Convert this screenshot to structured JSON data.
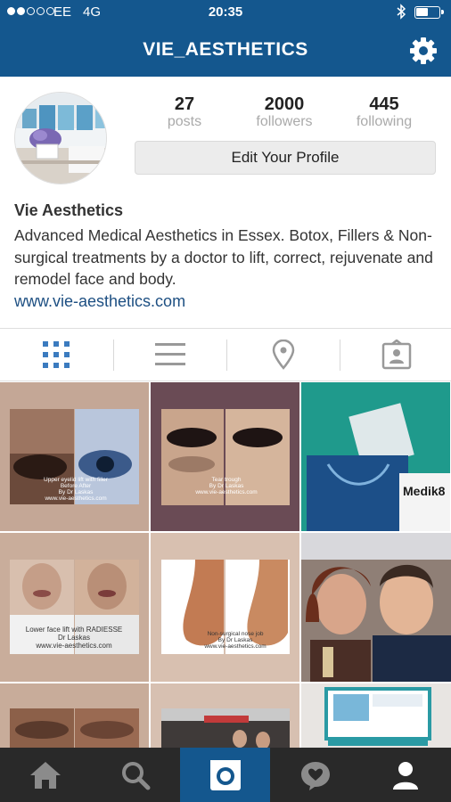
{
  "status_bar": {
    "carrier": "EE",
    "network": "4G",
    "time": "20:35",
    "signal_strength": "2 of 5",
    "battery_level": 0.55
  },
  "header": {
    "username": "VIE_AESTHETICS",
    "settings_icon": "gear-icon"
  },
  "profile": {
    "posts_count": "27",
    "posts_label": "posts",
    "followers_count": "2000",
    "followers_label": "followers",
    "following_count": "445",
    "following_label": "following",
    "edit_button": "Edit Your Profile",
    "name": "Vie Aesthetics",
    "bio": "Advanced Medical Aesthetics in Essex. Botox, Fillers & Non-surgical treatments by a doctor to lift, correct, rejuvenate and remodel face and body.",
    "website": "www.vie-aesthetics.com"
  },
  "view_tabs": [
    {
      "name": "grid-view",
      "icon": "grid-icon",
      "active": true
    },
    {
      "name": "list-view",
      "icon": "list-icon",
      "active": false
    },
    {
      "name": "map-view",
      "icon": "location-pin-icon",
      "active": false
    },
    {
      "name": "tagged-view",
      "icon": "tagged-person-icon",
      "active": false
    }
  ],
  "photo_captions": {
    "p1_line1": "Upper eyelid lift with filler",
    "p1_line2": "Before  After",
    "p1_line3": "By Dr Laskas",
    "p1_line4": "www.vie-aesthetics.com",
    "p2_line1": "Tear trough",
    "p2_line2": "By Dr Laskas",
    "p2_line3": "www.vie-aesthetics.com",
    "p3_brand": "Medik8",
    "p4_line1": "Lower face lift with RADIESSE",
    "p4_line2": "Dr Laskas",
    "p4_line3": "www.vie-aesthetics.com",
    "p5_line1": "Non-surgical nose job",
    "p5_line2": "By Dr Laskas",
    "p5_line3": "www.vie-aesthetics.com"
  },
  "bottom_tabs": [
    {
      "name": "home",
      "icon": "home-icon",
      "active": false
    },
    {
      "name": "explore",
      "icon": "search-icon",
      "active": false
    },
    {
      "name": "camera",
      "icon": "camera-icon",
      "active": true
    },
    {
      "name": "activity",
      "icon": "heart-bubble-icon",
      "active": false
    },
    {
      "name": "profile",
      "icon": "person-icon",
      "active": false
    }
  ],
  "colors": {
    "brand_blue": "#14578e",
    "link_blue": "#1d4f82",
    "tab_bar_dark": "#292929",
    "active_tab_blue": "#3b7bbf"
  }
}
